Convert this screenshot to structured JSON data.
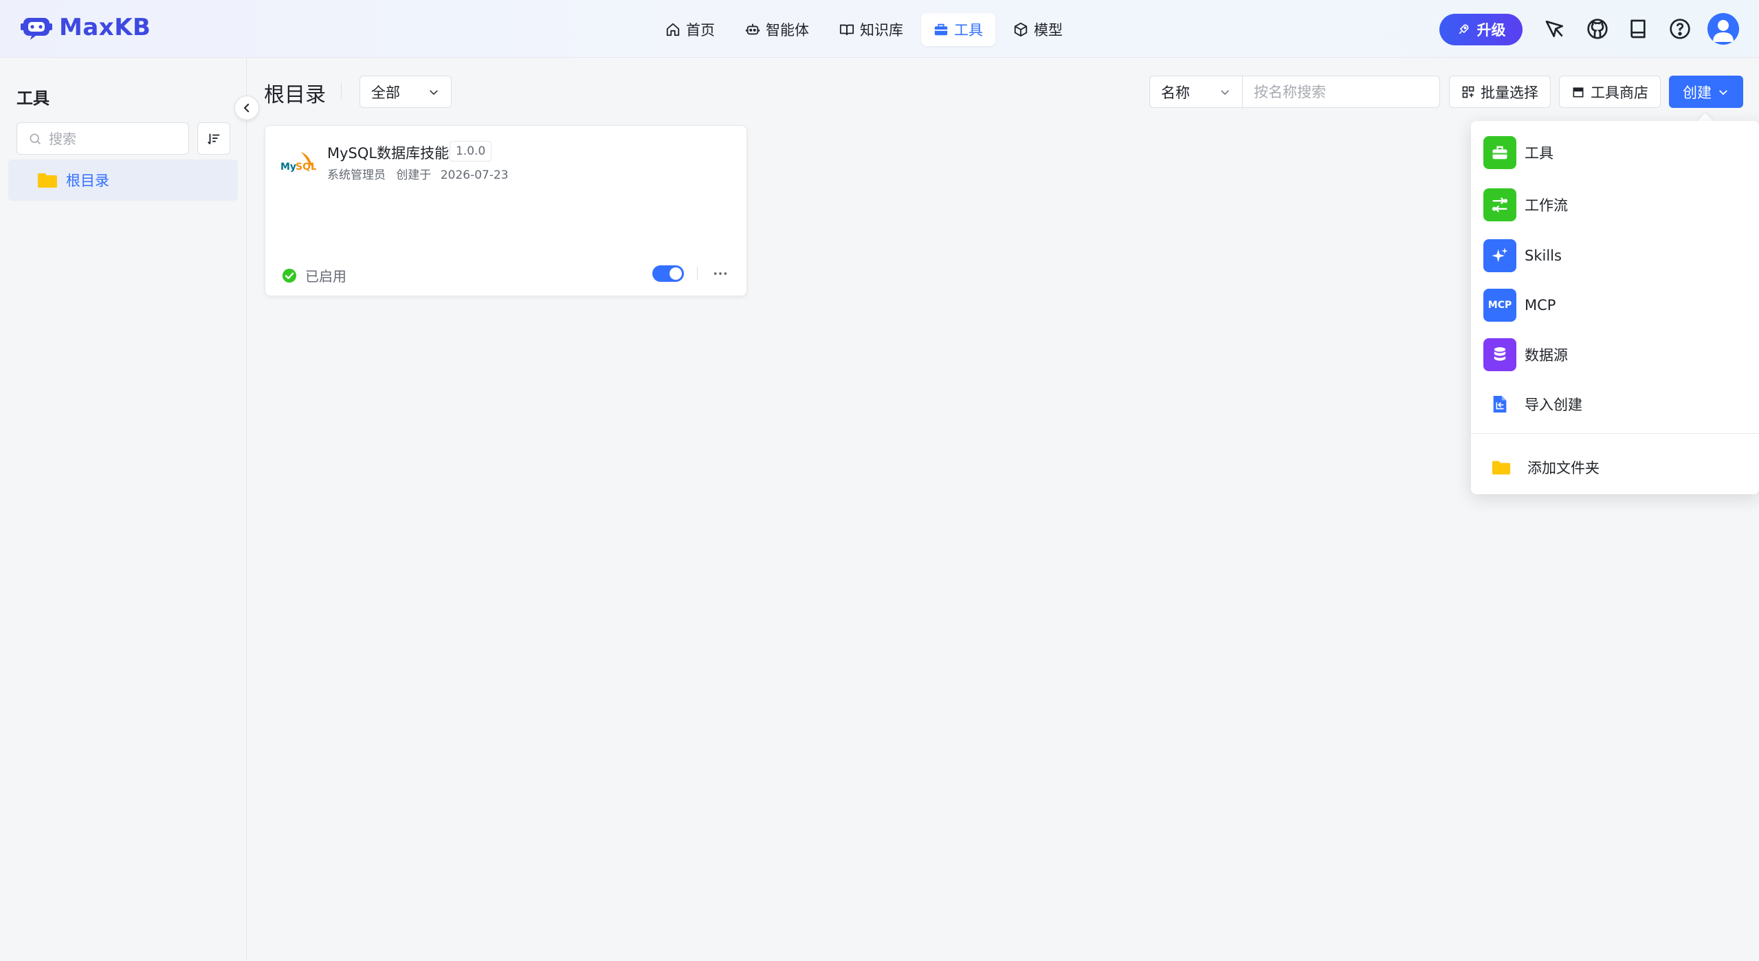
{
  "app": {
    "name": "MaxKB"
  },
  "nav": {
    "items": [
      {
        "label": "首页",
        "icon": "home-icon"
      },
      {
        "label": "智能体",
        "icon": "robot-icon"
      },
      {
        "label": "知识库",
        "icon": "book-icon"
      },
      {
        "label": "工具",
        "icon": "toolbox-icon",
        "active": true
      },
      {
        "label": "模型",
        "icon": "cube-icon"
      }
    ]
  },
  "header": {
    "upgrade_label": "升级",
    "icons": [
      "pin-icon",
      "github-icon",
      "docs-icon",
      "help-icon",
      "user-avatar"
    ]
  },
  "sidebar": {
    "title": "工具",
    "search_placeholder": "搜索",
    "tree": [
      {
        "label": "根目录",
        "selected": true
      }
    ]
  },
  "toolbar": {
    "title": "根目录",
    "filter_value": "全部",
    "field_value": "名称",
    "search_placeholder": "按名称搜索",
    "batch_label": "批量选择",
    "store_label": "工具商店",
    "create_label": "创建"
  },
  "cards": [
    {
      "name": "MySQL数据库技能",
      "version": "1.0.0",
      "creator": "系统管理员",
      "created_prefix": "创建于",
      "created_date": "2026-07-23",
      "status": "已启用",
      "enabled": true
    }
  ],
  "create_menu": {
    "items": [
      {
        "label": "工具",
        "icon": "toolbox-icon",
        "color": "#34c724"
      },
      {
        "label": "工作流",
        "icon": "workflow-icon",
        "color": "#34c724"
      },
      {
        "label": "Skills",
        "icon": "sparkle-icon",
        "color": "#3370ff"
      },
      {
        "label": "MCP",
        "icon": "mcp-icon",
        "badge": "MCP",
        "color": "#3370ff"
      },
      {
        "label": "数据源",
        "icon": "database-icon",
        "color": "#7f3bf5"
      },
      {
        "label": "导入创建",
        "icon": "import-file-icon",
        "color": "#3370ff"
      }
    ],
    "folder_label": "添加文件夹"
  },
  "colors": {
    "primary": "#3370ff",
    "brand": "#3d49e0",
    "success": "#34c724",
    "folder": "#ffc60a",
    "purple": "#7f3bf5"
  }
}
